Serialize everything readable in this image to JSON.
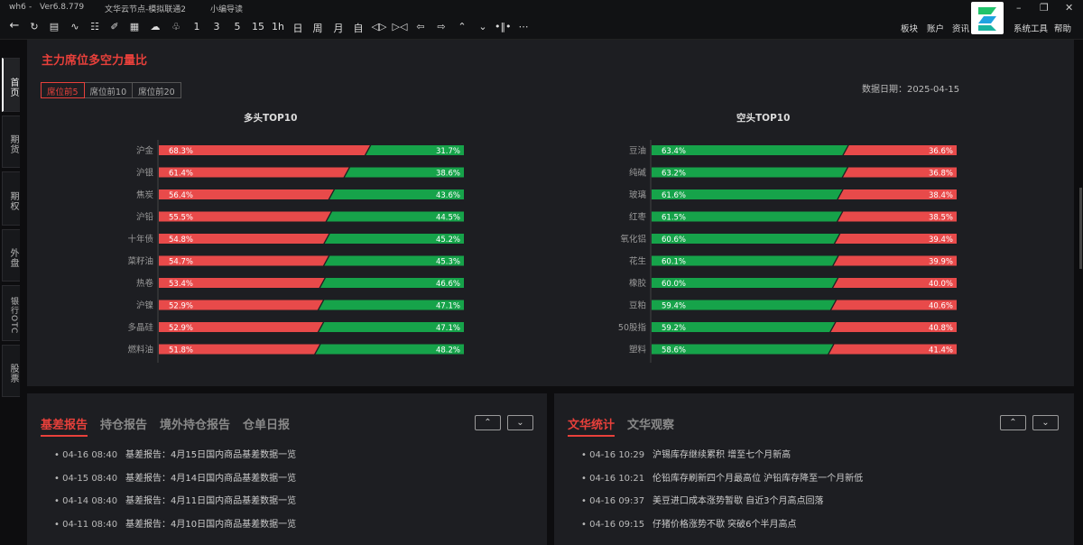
{
  "titlebar": {
    "app": "wh6",
    "sep": "-",
    "version": "Ver6.8.779",
    "node": "文华云节点-模拟联通2",
    "guide": "小编导读"
  },
  "toolbar": {
    "items": [
      "1",
      "3",
      "5",
      "15",
      "1h",
      "日",
      "周",
      "月",
      "自"
    ],
    "right_menu": [
      "板块",
      "账户",
      "资讯",
      "系统工具",
      "帮助"
    ]
  },
  "sidebar": {
    "tabs": [
      "首页",
      "期货",
      "期权",
      "外盘",
      "银行OTC",
      "股票"
    ]
  },
  "main": {
    "title": "主力席位多空力量比",
    "seg": [
      "席位前5",
      "席位前10",
      "席位前20"
    ],
    "date": "数据日期：2025-04-15",
    "long_title": "多头TOP10",
    "short_title": "空头TOP10"
  },
  "chart_data": [
    {
      "type": "bar",
      "title": "多头TOP10",
      "categories": [
        "沪金",
        "沪银",
        "焦炭",
        "沪铅",
        "十年债",
        "菜籽油",
        "热卷",
        "沪镍",
        "多晶硅",
        "燃料油"
      ],
      "series": [
        {
          "values": [
            68.3,
            61.4,
            56.4,
            55.5,
            54.8,
            54.7,
            53.4,
            52.9,
            52.9,
            51.8
          ]
        },
        {
          "values": [
            31.7,
            38.6,
            43.6,
            44.5,
            45.2,
            45.3,
            46.6,
            47.1,
            47.1,
            48.2
          ]
        }
      ],
      "colors": {
        "red": "#e84a4a",
        "green": "#16a34a"
      }
    },
    {
      "type": "bar",
      "title": "空头TOP10",
      "categories": [
        "豆油",
        "纯碱",
        "玻璃",
        "红枣",
        "氧化铝",
        "花生",
        "橡胶",
        "豆粕",
        "50股指",
        "塑料"
      ],
      "series": [
        {
          "values": [
            63.4,
            63.2,
            61.6,
            61.5,
            60.6,
            60.1,
            60.0,
            59.4,
            59.2,
            58.6
          ]
        },
        {
          "values": [
            36.6,
            36.8,
            38.4,
            38.5,
            39.4,
            39.9,
            40.0,
            40.6,
            40.8,
            41.4
          ]
        }
      ],
      "colors": {
        "green": "#16a34a",
        "red": "#e84a4a"
      }
    }
  ],
  "left_panel": {
    "tabs": [
      "基差报告",
      "持仓报告",
      "境外持仓报告",
      "仓单日报"
    ],
    "news": [
      {
        "time": "04-16 08:40",
        "text": "基差报告：4月15日国内商品基差数据一览"
      },
      {
        "time": "04-15 08:40",
        "text": "基差报告：4月14日国内商品基差数据一览"
      },
      {
        "time": "04-14 08:40",
        "text": "基差报告：4月11日国内商品基差数据一览"
      },
      {
        "time": "04-11 08:40",
        "text": "基差报告：4月10日国内商品基差数据一览"
      }
    ]
  },
  "right_panel": {
    "tabs": [
      "文华统计",
      "文华观察"
    ],
    "news": [
      {
        "time": "04-16 10:29",
        "text": "沪锡库存继续累积 增至七个月新高"
      },
      {
        "time": "04-16 10:21",
        "text": "伦铅库存刷新四个月最高位 沪铅库存降至一个月新低"
      },
      {
        "time": "04-16 09:37",
        "text": "美豆进口成本涨势暂歇 自近3个月高点回落"
      },
      {
        "time": "04-16 09:15",
        "text": "仔猪价格涨势不歇 突破6个半月高点"
      }
    ]
  }
}
